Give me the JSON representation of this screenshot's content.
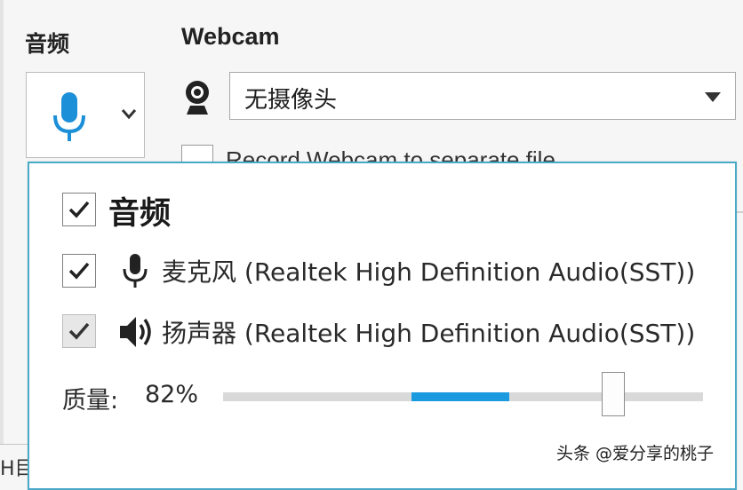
{
  "audio_panel": {
    "heading": "音频"
  },
  "webcam_panel": {
    "heading": "Webcam",
    "select_value": "无摄像头",
    "record_label": "Record Webcam to separate file"
  },
  "popup": {
    "audio_master_label": "音频",
    "audio_master_checked": true,
    "microphone_label": "麦克风 (Realtek High Definition Audio(SST))",
    "microphone_checked": true,
    "speaker_label": "扬声器 (Realtek High Definition Audio(SST))",
    "speaker_checked": true,
    "speaker_disabled": true,
    "quality_label": "质量:",
    "quality_value": "82%",
    "quality_level": 0.82
  },
  "bottom_left_text": "H目",
  "watermark": "头条 @爱分享的桃子",
  "colors": {
    "accent": "#1b9ae0",
    "popup_border": "#49aac8",
    "icon_blue": "#1b8fd8"
  }
}
